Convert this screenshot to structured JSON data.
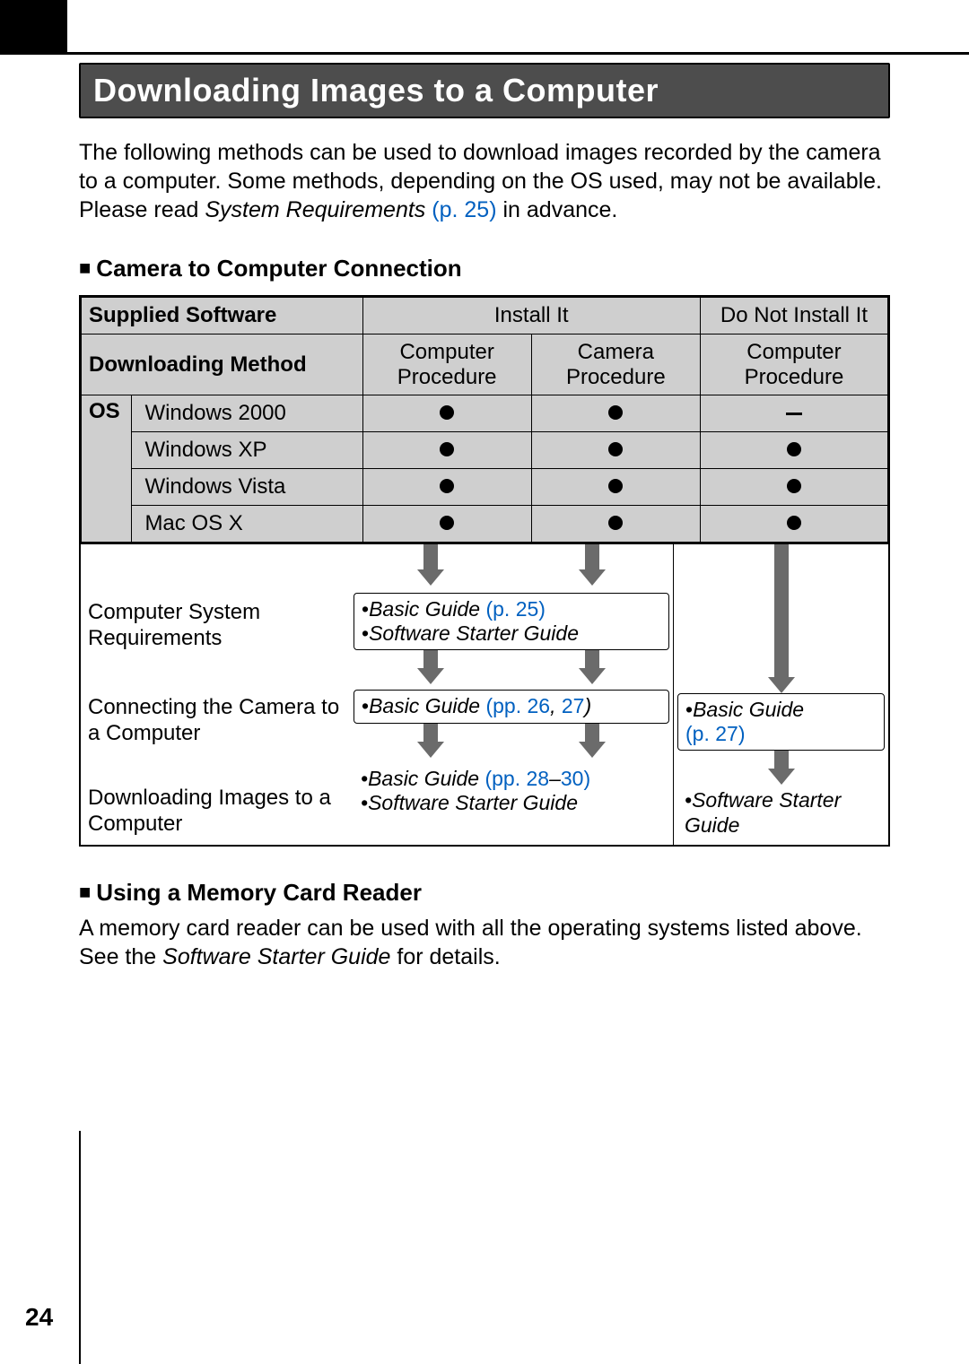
{
  "page_number": "24",
  "title": "Downloading Images to a Computer",
  "intro": {
    "t1": "The following methods can be used to download images recorded by the camera to a computer. Some methods, depending on the OS used, may not be available. Please read ",
    "ital": "System Requirements",
    "sp": " ",
    "link": "(p. 25)",
    "t2": " in advance."
  },
  "section1_head": "Camera to Computer Connection",
  "tbl": {
    "supplied_software": "Supplied Software",
    "install_it": "Install It",
    "do_not_install_it": "Do Not Install It",
    "downloading_method": "Downloading Method",
    "computer_procedure": "Computer Procedure",
    "camera_procedure": "Camera Procedure",
    "os_label": "OS",
    "os": [
      "Windows 2000",
      "Windows XP",
      "Windows Vista",
      "Mac OS X"
    ],
    "cells": [
      [
        "dot",
        "dot",
        "dash"
      ],
      [
        "dot",
        "dot",
        "dot"
      ],
      [
        "dot",
        "dot",
        "dot"
      ],
      [
        "dot",
        "dot",
        "dot"
      ]
    ]
  },
  "flow": {
    "labels": [
      "Computer System Requirements",
      "Connecting the Camera to a Computer",
      "Downloading Images to a Computer"
    ],
    "mid1": {
      "a": "•",
      "b": "Basic Guide",
      "c": " ",
      "d": "(p. 25)",
      "e": "•",
      "f": "Software Starter Guide"
    },
    "mid2": {
      "a": "•",
      "b": "Basic Guide",
      "c": " ",
      "d": "(pp. 26",
      "e": ", ",
      "f": "27",
      "g": ")"
    },
    "mid3": {
      "a": "•",
      "b": "Basic Guide",
      "c": " ",
      "d": "(pp. 28",
      "e": "–",
      "f": "30)",
      "g": "•",
      "h": "Software Starter Guide"
    },
    "right2": {
      "a": "•",
      "b": "Basic Guide",
      "c": "(p. 27)"
    },
    "right3": {
      "a": "•",
      "b": "Software Starter Guide"
    }
  },
  "section2_head": "Using a Memory Card Reader",
  "section2_para": {
    "t1": "A memory card reader can be used with all the operating systems listed above. See the ",
    "ital": "Software Starter Guide",
    "t2": " for details."
  }
}
